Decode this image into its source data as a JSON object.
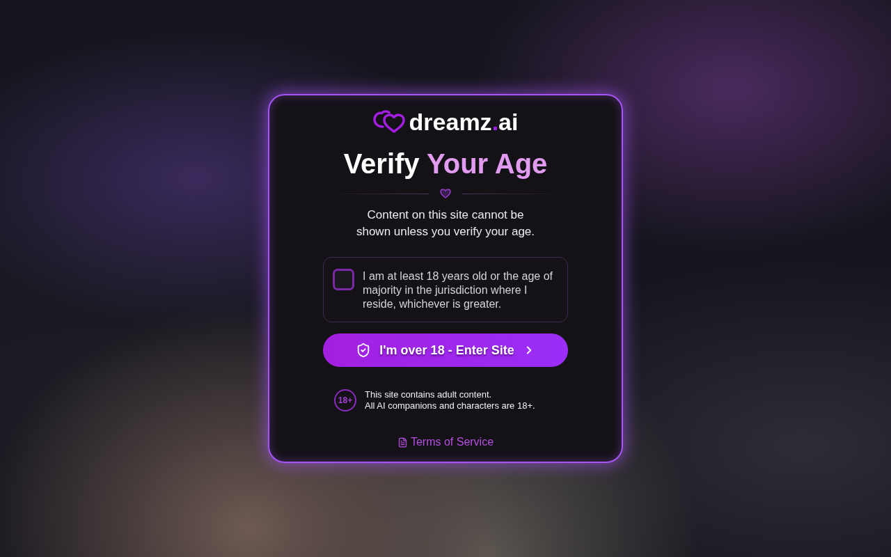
{
  "logo": {
    "parts": [
      {
        "text": "dreamz",
        "accent": false
      },
      {
        "text": ".",
        "accent": true
      },
      {
        "text": "ai",
        "accent": false
      }
    ]
  },
  "title": {
    "parts": [
      {
        "text": "Verify",
        "accent": false
      },
      {
        "text": "Your Age",
        "accent": true
      }
    ]
  },
  "description": "Content on this site cannot be shown unless you verify your age.",
  "consent": {
    "checked": false,
    "label": "I am at least 18 years old or the age of majority in the jurisdiction where I reside, whichever is greater."
  },
  "enter_button": {
    "label": "I'm over 18 - Enter Site"
  },
  "notice": {
    "badge": "18+",
    "lines": [
      "This site contains adult content.",
      "All AI companions and characters are 18+."
    ]
  },
  "terms_link": {
    "label": "Terms of Service"
  }
}
